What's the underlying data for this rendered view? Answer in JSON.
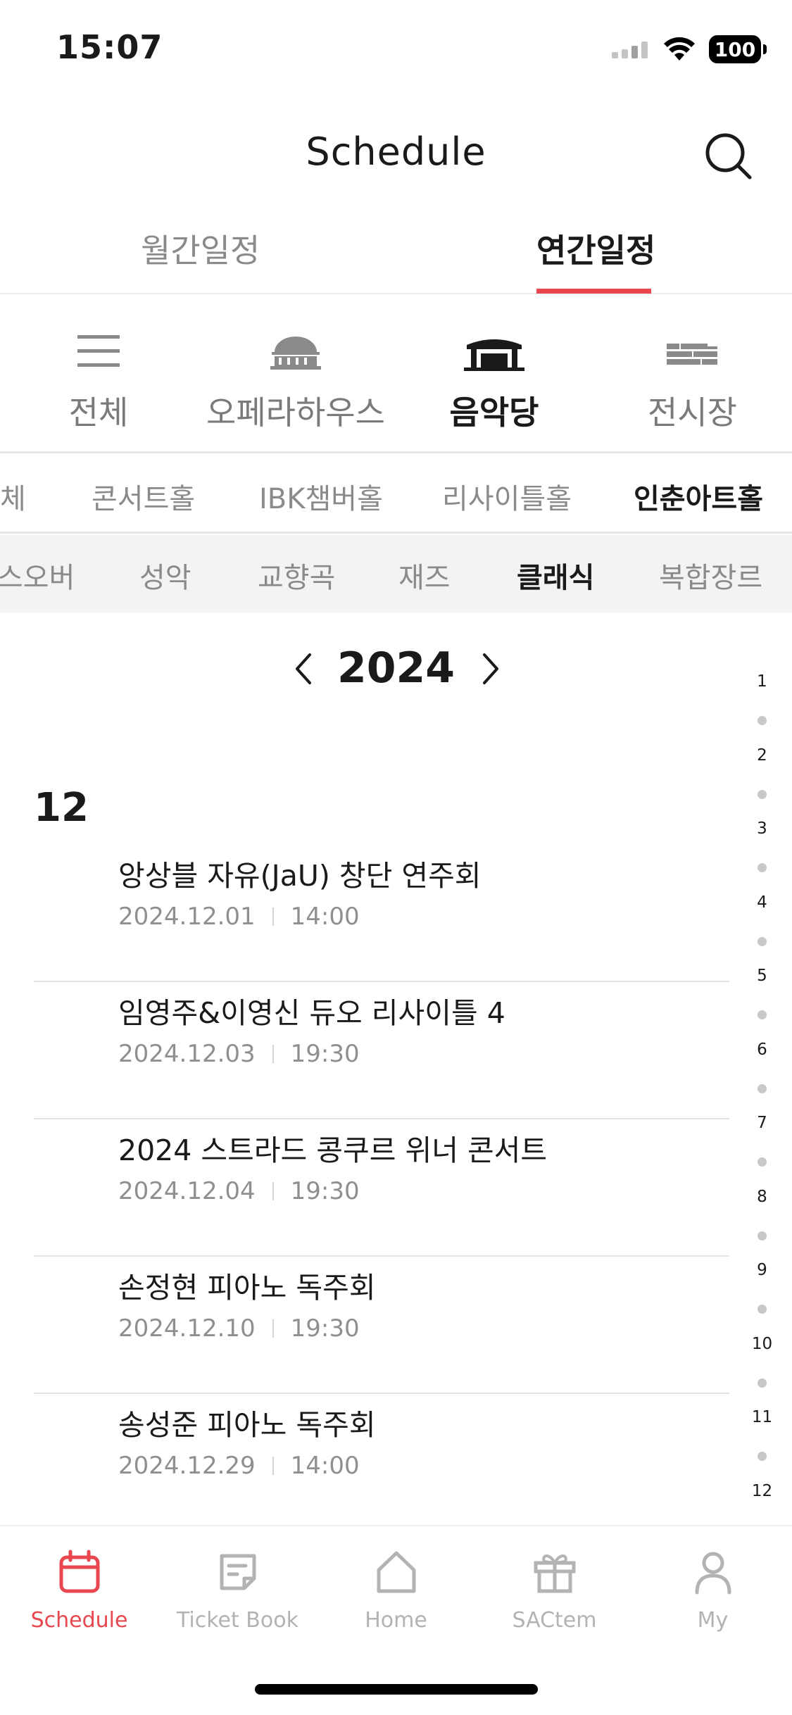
{
  "status_bar": {
    "time": "15:07",
    "battery": "100"
  },
  "header": {
    "title": "Schedule"
  },
  "period_tabs": [
    {
      "label": "월간일정",
      "active": false
    },
    {
      "label": "연간일정",
      "active": true
    }
  ],
  "venues": [
    {
      "label": "전체",
      "icon": "menu-icon",
      "active": false
    },
    {
      "label": "오페라하우스",
      "icon": "opera-house-icon",
      "active": false
    },
    {
      "label": "음악당",
      "icon": "concert-hall-icon",
      "active": true
    },
    {
      "label": "전시장",
      "icon": "exhibition-icon",
      "active": false
    }
  ],
  "halls": [
    {
      "label": "체",
      "active": false
    },
    {
      "label": "콘서트홀",
      "active": false
    },
    {
      "label": "IBK챔버홀",
      "active": false
    },
    {
      "label": "리사이틀홀",
      "active": false
    },
    {
      "label": "인춘아트홀",
      "active": true
    }
  ],
  "genres": [
    {
      "label": "스오버",
      "active": false
    },
    {
      "label": "성악",
      "active": false
    },
    {
      "label": "교향곡",
      "active": false
    },
    {
      "label": "재즈",
      "active": false
    },
    {
      "label": "클래식",
      "active": true
    },
    {
      "label": "복합장르",
      "active": false
    }
  ],
  "year_nav": {
    "year": "2024"
  },
  "month_heading": "12",
  "events": [
    {
      "title": "앙상블 자유(JaU) 창단 연주회",
      "date": "2024.12.01",
      "time": "14:00"
    },
    {
      "title": "임영주&이영신 듀오 리사이틀 4",
      "date": "2024.12.03",
      "time": "19:30"
    },
    {
      "title": "2024 스트라드 콩쿠르 위너 콘서트",
      "date": "2024.12.04",
      "time": "19:30"
    },
    {
      "title": "손정현 피아노 독주회",
      "date": "2024.12.10",
      "time": "19:30"
    },
    {
      "title": "송성준 피아노 독주회",
      "date": "2024.12.29",
      "time": "14:00"
    }
  ],
  "month_index": [
    "1",
    "2",
    "3",
    "4",
    "5",
    "6",
    "7",
    "8",
    "9",
    "10",
    "11",
    "12"
  ],
  "bottom_nav": [
    {
      "label": "Schedule",
      "icon": "calendar-icon",
      "active": true
    },
    {
      "label": "Ticket Book",
      "icon": "ticket-book-icon",
      "active": false
    },
    {
      "label": "Home",
      "icon": "home-icon",
      "active": false
    },
    {
      "label": "SACtem",
      "icon": "gift-icon",
      "active": false
    },
    {
      "label": "My",
      "icon": "person-icon",
      "active": false
    }
  ],
  "colors": {
    "accent": "#e8474f",
    "inactive_text": "#8a8a8a",
    "divider": "#e6e6e6",
    "genre_bg": "#f3f3f3"
  }
}
